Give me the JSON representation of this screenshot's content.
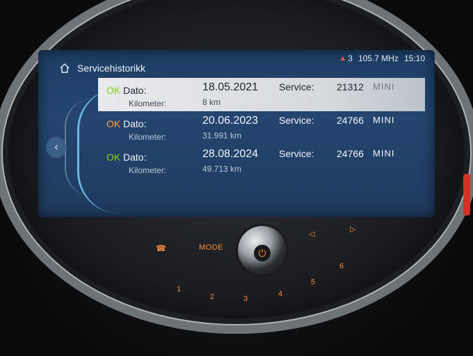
{
  "status": {
    "alert_count": "3",
    "radio": "105.7 MHz",
    "time": "15:10"
  },
  "header": {
    "title": "Servicehistorikk"
  },
  "rows": [
    {
      "ok": "OK",
      "ok_color": "#7ed321",
      "date_label": "Dato:",
      "date": "18.05.2021",
      "km_label": "Kilometer:",
      "km": "8 km",
      "service_label": "Service:",
      "service_code": "21312",
      "brand": "MINI",
      "selected": true
    },
    {
      "ok": "OK",
      "ok_color": "#ff9f43",
      "date_label": "Dato:",
      "date": "20.06.2023",
      "km_label": "Kilometer:",
      "km": "31.991 km",
      "service_label": "Service:",
      "service_code": "24766",
      "brand": "MINI",
      "selected": false
    },
    {
      "ok": "OK",
      "ok_color": "#7ed321",
      "date_label": "Dato:",
      "date": "28.08.2024",
      "km_label": "Kilometer:",
      "km": "49.713 km",
      "service_label": "Service:",
      "service_code": "24766",
      "brand": "MINI",
      "selected": false
    }
  ],
  "console": {
    "mode": "MODE",
    "presets": [
      "1",
      "2",
      "3",
      "4",
      "5",
      "6"
    ]
  },
  "icons": {
    "home": "home-icon",
    "back": "chevron-left-icon",
    "alert": "warning-icon",
    "power": "power-icon",
    "phone": "phone-icon",
    "prev": "prev-icon",
    "next": "next-icon"
  },
  "colors": {
    "screen": "#24456f",
    "accent_orange": "#ff8f3a",
    "ok_green": "#7ed321",
    "ok_orange": "#ff9f43",
    "selection": "#e8eaec"
  }
}
